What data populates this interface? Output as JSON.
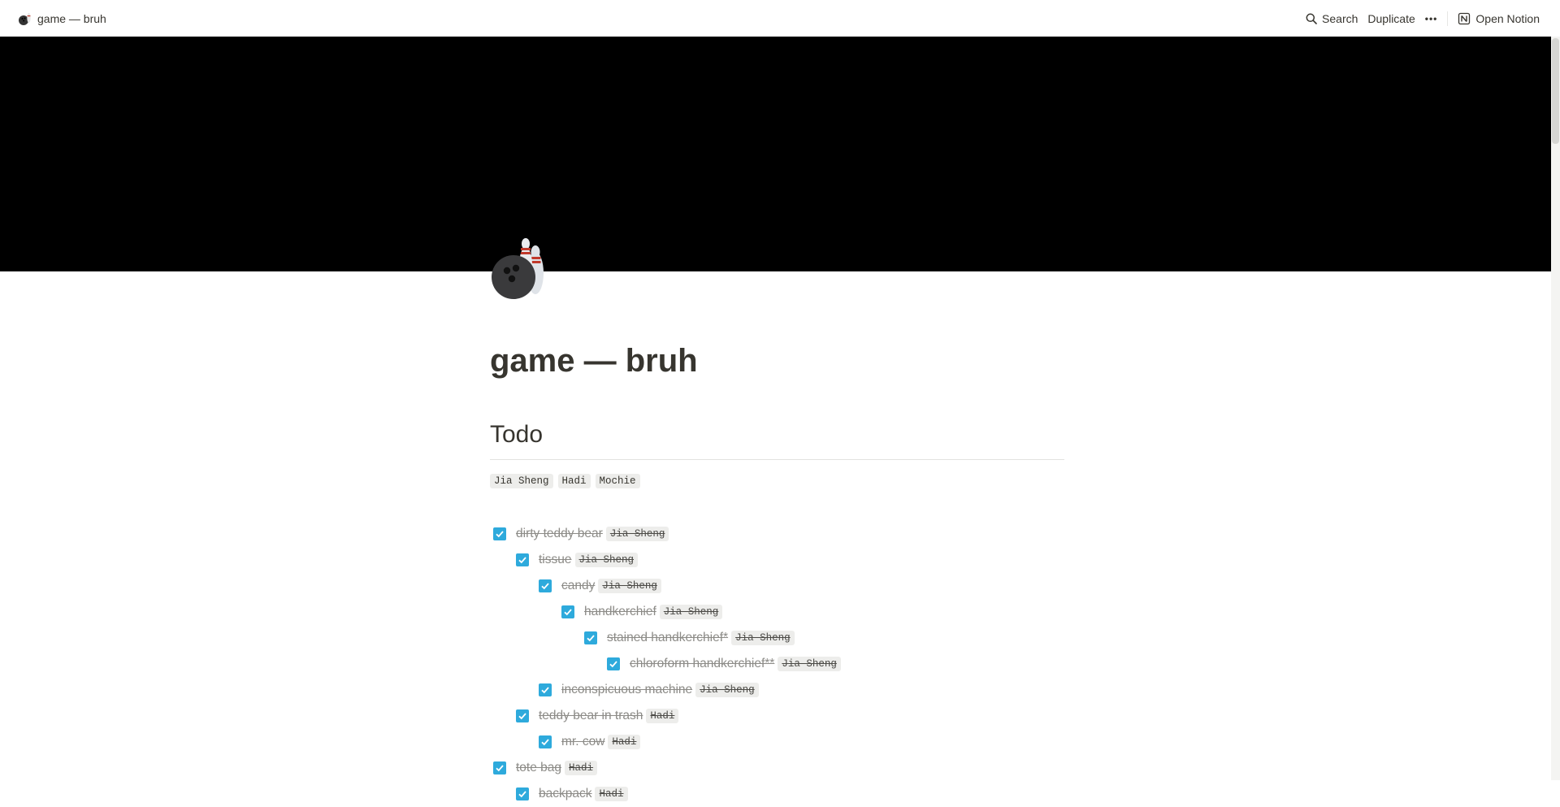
{
  "topbar": {
    "breadcrumb_title": "game — bruh",
    "search_label": "Search",
    "duplicate_label": "Duplicate",
    "more_label": "•••",
    "open_notion_label": "Open Notion"
  },
  "page": {
    "title": "game — bruh",
    "heading": "Todo",
    "tags": [
      "Jia Sheng",
      "Hadi",
      "Mochie"
    ]
  },
  "todos": [
    {
      "text": "dirty teddy bear",
      "assignee": "Jia Sheng",
      "checked": true,
      "level": 0
    },
    {
      "text": "tissue",
      "assignee": "Jia Sheng",
      "checked": true,
      "level": 1
    },
    {
      "text": "candy",
      "assignee": "Jia Sheng",
      "checked": true,
      "level": 2
    },
    {
      "text": "handkerchief",
      "assignee": "Jia Sheng",
      "checked": true,
      "level": 3
    },
    {
      "text": "stained handkerchief*",
      "assignee": "Jia Sheng",
      "checked": true,
      "level": 4
    },
    {
      "text": "chloroform handkerchief**",
      "assignee": "Jia Sheng",
      "checked": true,
      "level": 5
    },
    {
      "text": "inconspicuous machine",
      "assignee": "Jia Sheng",
      "checked": true,
      "level": 2
    },
    {
      "text": "teddy bear in trash",
      "assignee": "Hadi",
      "checked": true,
      "level": 1
    },
    {
      "text": "mr. cow",
      "assignee": "Hadi",
      "checked": true,
      "level": 2
    },
    {
      "text": "tote bag",
      "assignee": "Hadi",
      "checked": true,
      "level": 0
    },
    {
      "text": "backpack",
      "assignee": "Hadi",
      "checked": true,
      "level": 1
    }
  ],
  "colors": {
    "checkbox": "#2eaadc",
    "cover": "#000000",
    "text": "#37352f",
    "done_text": "#8c8b87"
  },
  "icons": {
    "page_icon": "bowling-icon",
    "search": "search-icon",
    "notion": "notion-logo-icon"
  }
}
